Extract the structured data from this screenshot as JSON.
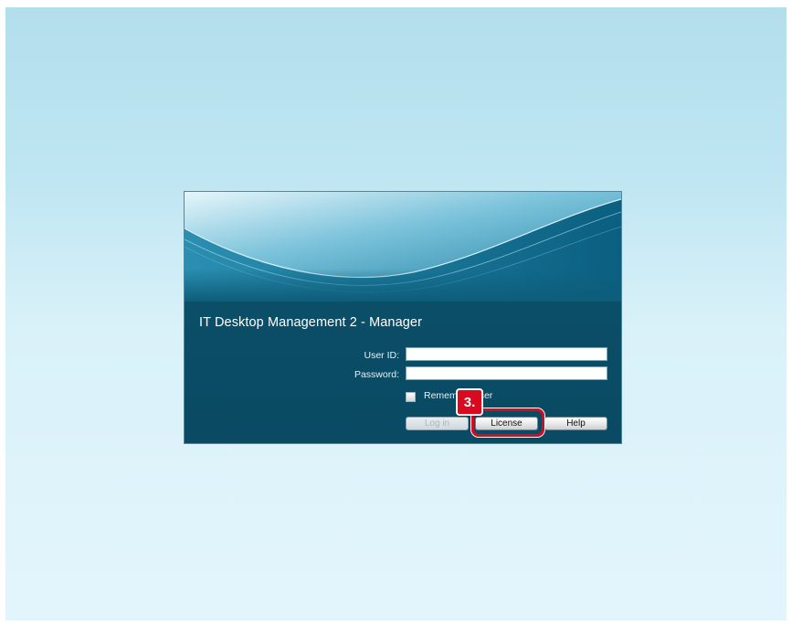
{
  "dialog": {
    "title": "IT Desktop Management 2 - Manager",
    "user_id_label": "User ID:",
    "user_id_value": "",
    "password_label": "Password:",
    "password_value": "",
    "remember_label": "Remember user",
    "remember_checked": false,
    "buttons": {
      "login": "Log in",
      "license": "License",
      "help": "Help"
    }
  },
  "annotation": {
    "step_number": "3.",
    "highlight_color": "#d9091f",
    "highlight_target": "license-button"
  },
  "colors": {
    "background_top": "#b3deec",
    "background_bottom": "#e3f5fc",
    "dialog": "#0b4e68"
  }
}
